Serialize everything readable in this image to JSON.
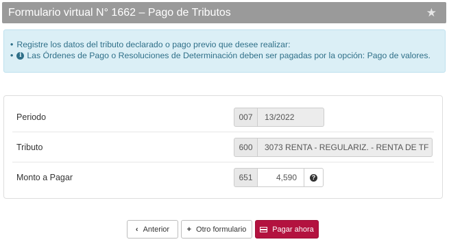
{
  "header": {
    "title": "Formulario virtual N° 1662 – Pago de Tributos",
    "star_icon": "star-icon"
  },
  "info": {
    "items": [
      "Registre los datos del tributo declarado o pago previo que desee realizar:",
      "Las Órdenes de Pago o Resoluciones de Determinación deben ser pagadas por la opción: Pago de valores."
    ],
    "info_icon": "info-circle-icon"
  },
  "form": {
    "periodo": {
      "label": "Periodo",
      "code": "007",
      "value": "13/2022"
    },
    "tributo": {
      "label": "Tributo",
      "code": "600",
      "value": "3073 RENTA - REGULARIZ. - RENTA DE TF"
    },
    "monto": {
      "label": "Monto a Pagar",
      "code": "651",
      "value": "4,590",
      "help_icon": "question-circle-icon"
    }
  },
  "actions": {
    "anterior": "Anterior",
    "otro": "Otro formulario",
    "pagar": "Pagar ahora"
  },
  "colors": {
    "header_bg": "#9a9a9a",
    "info_bg": "#dbeff6",
    "info_text": "#2f6f88",
    "primary": "#b3123f"
  }
}
